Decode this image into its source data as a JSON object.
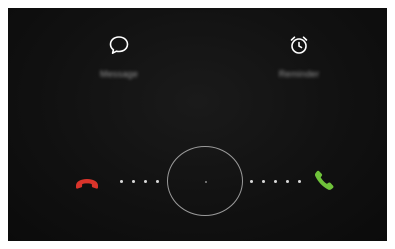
{
  "quick_actions": {
    "message": {
      "label": "Message",
      "icon": "speech-bubble-icon"
    },
    "reminder": {
      "label": "Reminder",
      "icon": "alarm-clock-icon"
    }
  },
  "incoming_call": {
    "decline_icon": "phone-hangup-icon",
    "accept_icon": "phone-answer-icon",
    "colors": {
      "decline": "#d9342b",
      "accept": "#6fc23a",
      "background": "#111111"
    }
  }
}
